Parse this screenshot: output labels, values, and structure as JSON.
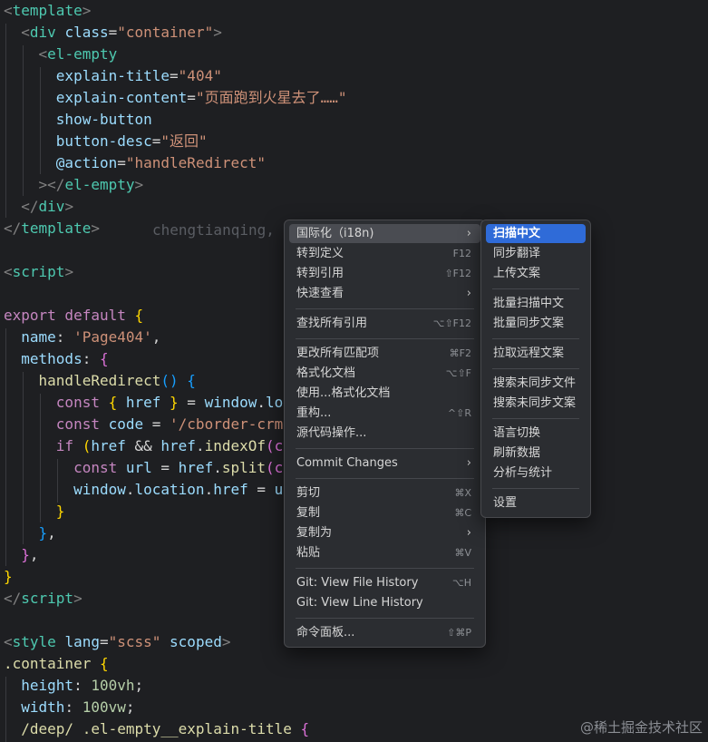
{
  "code": {
    "lines": [
      [
        [
          "t-punct",
          "<"
        ],
        [
          "t-tag",
          "template"
        ],
        [
          "t-punct",
          ">"
        ]
      ],
      [
        [
          "t-plain",
          "  "
        ],
        [
          "t-punct",
          "<"
        ],
        [
          "t-tag",
          "div "
        ],
        [
          "t-attr",
          "class"
        ],
        [
          "t-plain",
          "="
        ],
        [
          "t-str",
          "\"container\""
        ],
        [
          "t-punct",
          ">"
        ]
      ],
      [
        [
          "t-plain",
          "    "
        ],
        [
          "t-punct",
          "<"
        ],
        [
          "t-tag",
          "el-empty"
        ]
      ],
      [
        [
          "t-plain",
          "      "
        ],
        [
          "t-attr",
          "explain-title"
        ],
        [
          "t-plain",
          "="
        ],
        [
          "t-str",
          "\"404\""
        ]
      ],
      [
        [
          "t-plain",
          "      "
        ],
        [
          "t-attr",
          "explain-content"
        ],
        [
          "t-plain",
          "="
        ],
        [
          "t-str",
          "\"页面跑到火星去了……\""
        ]
      ],
      [
        [
          "t-plain",
          "      "
        ],
        [
          "t-attr",
          "show-button"
        ]
      ],
      [
        [
          "t-plain",
          "      "
        ],
        [
          "t-attr",
          "button-desc"
        ],
        [
          "t-plain",
          "="
        ],
        [
          "t-str",
          "\"返回\""
        ]
      ],
      [
        [
          "t-plain",
          "      "
        ],
        [
          "t-attr",
          "@action"
        ],
        [
          "t-plain",
          "="
        ],
        [
          "t-str",
          "\"handleRedirect\""
        ]
      ],
      [
        [
          "t-plain",
          "    "
        ],
        [
          "t-punct",
          "></"
        ],
        [
          "t-tag",
          "el-empty"
        ],
        [
          "t-punct",
          ">"
        ]
      ],
      [
        [
          "t-plain",
          "  "
        ],
        [
          "t-punct",
          "</"
        ],
        [
          "t-tag",
          "div"
        ],
        [
          "t-punct",
          ">"
        ]
      ],
      [
        [
          "t-punct",
          "</"
        ],
        [
          "t-tag",
          "template"
        ],
        [
          "t-punct",
          ">"
        ]
      ],
      [],
      [
        [
          "t-punct",
          "<"
        ],
        [
          "t-tag",
          "script"
        ],
        [
          "t-punct",
          ">"
        ]
      ],
      [],
      [
        [
          "t-kw",
          "export default "
        ],
        [
          "t-yellow",
          "{"
        ]
      ],
      [
        [
          "t-plain",
          "  "
        ],
        [
          "t-var",
          "name"
        ],
        [
          "t-plain",
          ": "
        ],
        [
          "t-str",
          "'Page404'"
        ],
        [
          "t-plain",
          ","
        ]
      ],
      [
        [
          "t-plain",
          "  "
        ],
        [
          "t-var",
          "methods"
        ],
        [
          "t-plain",
          ": "
        ],
        [
          "t-pink",
          "{"
        ]
      ],
      [
        [
          "t-plain",
          "    "
        ],
        [
          "t-fn",
          "handleRedirect"
        ],
        [
          "t-blue",
          "()"
        ],
        [
          "t-plain",
          " "
        ],
        [
          "t-blue",
          "{"
        ]
      ],
      [
        [
          "t-plain",
          "      "
        ],
        [
          "t-kw",
          "const "
        ],
        [
          "t-yellow",
          "{ "
        ],
        [
          "t-var",
          "href"
        ],
        [
          "t-yellow",
          " }"
        ],
        [
          "t-plain",
          " = "
        ],
        [
          "t-var",
          "window"
        ],
        [
          "t-plain",
          "."
        ],
        [
          "t-var",
          "lo"
        ]
      ],
      [
        [
          "t-plain",
          "      "
        ],
        [
          "t-kw",
          "const "
        ],
        [
          "t-var",
          "code"
        ],
        [
          "t-plain",
          " = "
        ],
        [
          "t-str",
          "'/cborder-crm"
        ]
      ],
      [
        [
          "t-plain",
          "      "
        ],
        [
          "t-kw",
          "if "
        ],
        [
          "t-yellow",
          "("
        ],
        [
          "t-var",
          "href"
        ],
        [
          "t-plain",
          " && "
        ],
        [
          "t-var",
          "href"
        ],
        [
          "t-plain",
          "."
        ],
        [
          "t-fn",
          "indexOf"
        ],
        [
          "t-pink",
          "(c"
        ]
      ],
      [
        [
          "t-plain",
          "        "
        ],
        [
          "t-kw",
          "const "
        ],
        [
          "t-var",
          "url"
        ],
        [
          "t-plain",
          " = "
        ],
        [
          "t-var",
          "href"
        ],
        [
          "t-plain",
          "."
        ],
        [
          "t-fn",
          "split"
        ],
        [
          "t-pink",
          "(c"
        ]
      ],
      [
        [
          "t-plain",
          "        "
        ],
        [
          "t-var",
          "window"
        ],
        [
          "t-plain",
          "."
        ],
        [
          "t-var",
          "location"
        ],
        [
          "t-plain",
          "."
        ],
        [
          "t-var",
          "href"
        ],
        [
          "t-plain",
          " = "
        ],
        [
          "t-var",
          "u"
        ]
      ],
      [
        [
          "t-plain",
          "      "
        ],
        [
          "t-yellow",
          "}"
        ]
      ],
      [
        [
          "t-plain",
          "    "
        ],
        [
          "t-blue",
          "}"
        ],
        [
          "t-plain",
          ","
        ]
      ],
      [
        [
          "t-plain",
          "  "
        ],
        [
          "t-pink",
          "}"
        ],
        [
          "t-plain",
          ","
        ]
      ],
      [
        [
          "t-yellow",
          "}"
        ]
      ],
      [
        [
          "t-punct",
          "</"
        ],
        [
          "t-tag",
          "script"
        ],
        [
          "t-punct",
          ">"
        ]
      ],
      [],
      [
        [
          "t-punct",
          "<"
        ],
        [
          "t-tag",
          "style "
        ],
        [
          "t-attr",
          "lang"
        ],
        [
          "t-plain",
          "="
        ],
        [
          "t-str",
          "\"scss\""
        ],
        [
          "t-attr",
          " scoped"
        ],
        [
          "t-punct",
          ">"
        ]
      ],
      [
        [
          "t-fn",
          ".container "
        ],
        [
          "t-yellow",
          "{"
        ]
      ],
      [
        [
          "t-plain",
          "  "
        ],
        [
          "t-var",
          "height"
        ],
        [
          "t-plain",
          ": "
        ],
        [
          "t-num",
          "100vh"
        ],
        [
          "t-plain",
          ";"
        ]
      ],
      [
        [
          "t-plain",
          "  "
        ],
        [
          "t-var",
          "width"
        ],
        [
          "t-plain",
          ": "
        ],
        [
          "t-num",
          "100vw"
        ],
        [
          "t-plain",
          ";"
        ]
      ],
      [
        [
          "t-plain",
          "  "
        ],
        [
          "t-fn",
          "/deep/ .el-empty__explain-title "
        ],
        [
          "t-pink",
          "{"
        ]
      ]
    ],
    "blame": "chengtianqing,"
  },
  "main_menu": {
    "items": [
      {
        "label": "国际化（i18n)",
        "shortcut": "",
        "arrow": "›",
        "state": "soft"
      },
      {
        "label": "转到定义",
        "shortcut": "F12",
        "arrow": ""
      },
      {
        "label": "转到引用",
        "shortcut": "⇧F12",
        "arrow": ""
      },
      {
        "label": "快速查看",
        "shortcut": "",
        "arrow": "›"
      },
      {
        "sep": true
      },
      {
        "label": "查找所有引用",
        "shortcut": "⌥⇧F12",
        "arrow": ""
      },
      {
        "sep": true
      },
      {
        "label": "更改所有匹配项",
        "shortcut": "⌘F2",
        "arrow": ""
      },
      {
        "label": "格式化文档",
        "shortcut": "⌥⇧F",
        "arrow": ""
      },
      {
        "label": "使用...格式化文档",
        "shortcut": "",
        "arrow": ""
      },
      {
        "label": "重构...",
        "shortcut": "^⇧R",
        "arrow": ""
      },
      {
        "label": "源代码操作...",
        "shortcut": "",
        "arrow": ""
      },
      {
        "sep": true
      },
      {
        "label": "Commit Changes",
        "shortcut": "",
        "arrow": "›"
      },
      {
        "sep": true
      },
      {
        "label": "剪切",
        "shortcut": "⌘X",
        "arrow": ""
      },
      {
        "label": "复制",
        "shortcut": "⌘C",
        "arrow": ""
      },
      {
        "label": "复制为",
        "shortcut": "",
        "arrow": "›"
      },
      {
        "label": "粘贴",
        "shortcut": "⌘V",
        "arrow": ""
      },
      {
        "sep": true
      },
      {
        "label": "Git: View File History",
        "shortcut": "⌥H",
        "arrow": ""
      },
      {
        "label": "Git: View Line History",
        "shortcut": "",
        "arrow": ""
      },
      {
        "sep": true
      },
      {
        "label": "命令面板...",
        "shortcut": "⇧⌘P",
        "arrow": ""
      }
    ]
  },
  "sub_menu": {
    "items": [
      {
        "label": "扫描中文",
        "state": "active"
      },
      {
        "label": "同步翻译"
      },
      {
        "label": "上传文案"
      },
      {
        "sep": true
      },
      {
        "label": "批量扫描中文"
      },
      {
        "label": "批量同步文案"
      },
      {
        "sep": true
      },
      {
        "label": "拉取远程文案"
      },
      {
        "sep": true
      },
      {
        "label": "搜索未同步文件"
      },
      {
        "label": "搜索未同步文案"
      },
      {
        "sep": true
      },
      {
        "label": "语言切换"
      },
      {
        "label": "刷新数据"
      },
      {
        "label": "分析与统计"
      },
      {
        "sep": true
      },
      {
        "label": "设置"
      }
    ]
  },
  "watermark": "@稀土掘金技术社区"
}
